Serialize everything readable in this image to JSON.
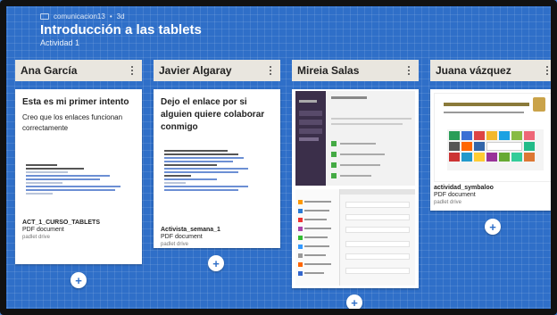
{
  "header": {
    "author": "comunicacion13",
    "age": "3d",
    "title": "Introducción a las tablets",
    "subtitle": "Actividad 1"
  },
  "columns": [
    {
      "name": "Ana García",
      "card": {
        "title": "Esta es mi primer intento",
        "text": "Creo que los enlaces funcionan correctamente",
        "attachment_title": "ACT_1_CURSO_TABLETS",
        "attachment_type": "PDF document",
        "attachment_source": "padlet drive"
      }
    },
    {
      "name": "Javier Algaray",
      "card": {
        "title": "Dejo el enlace por si alguien quiere colaborar conmigo",
        "attachment_title": "Activista_semana_1",
        "attachment_type": "PDF document",
        "attachment_source": "padlet drive"
      }
    },
    {
      "name": "Mireia Salas",
      "card": {}
    },
    {
      "name": "Juana vázquez",
      "card": {
        "attachment_title": "actividad_symbaloo",
        "attachment_type": "PDF document",
        "attachment_source": "padlet drive"
      }
    }
  ],
  "colors": {
    "background": "#2f6fc8",
    "column_header": "#e9e6df",
    "card": "#ffffff"
  }
}
